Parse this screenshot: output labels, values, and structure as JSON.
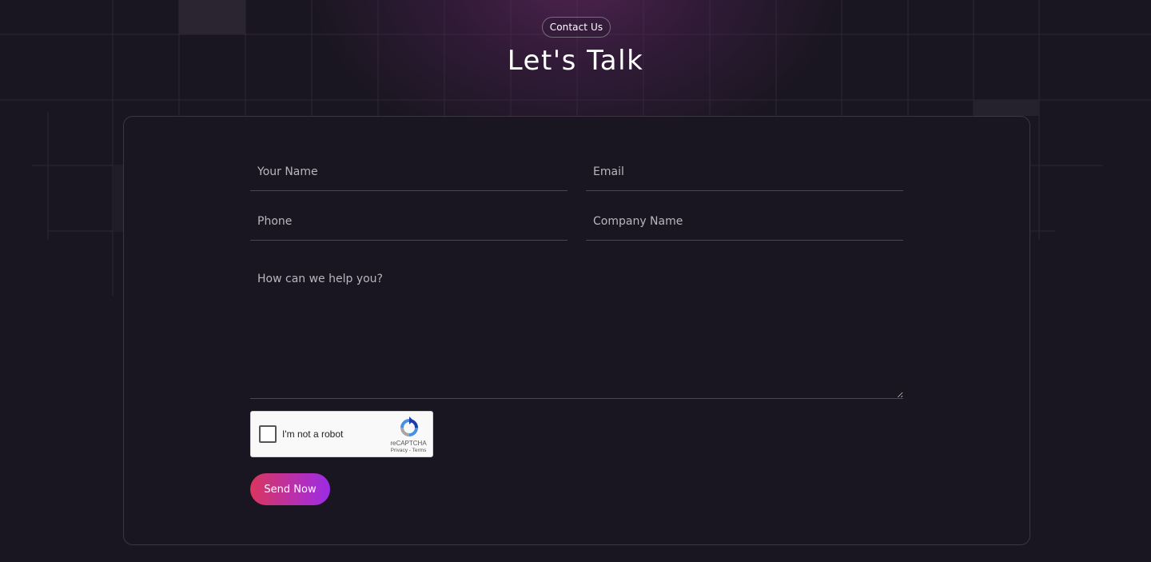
{
  "header": {
    "badge": "Contact Us",
    "title": "Let's Talk"
  },
  "form": {
    "name_placeholder": "Your Name",
    "email_placeholder": "Email",
    "phone_placeholder": "Phone",
    "company_placeholder": "Company Name",
    "message_placeholder": "How can we help you?",
    "submit_label": "Send Now"
  },
  "captcha": {
    "label": "I'm not a robot",
    "brand": "reCAPTCHA",
    "links": "Privacy - Terms",
    "checked": false
  },
  "colors": {
    "background": "#1a1621",
    "accent_start": "#d9365d",
    "accent_end": "#9b2ce6",
    "glow": "#7a2d76"
  },
  "icons": {
    "captcha_logo": "recaptcha-logo-icon"
  }
}
